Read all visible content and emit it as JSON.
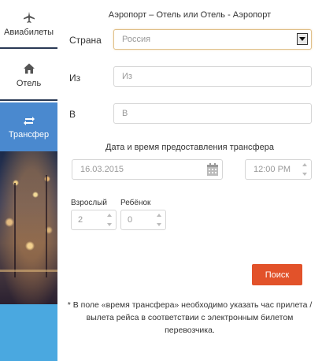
{
  "sidebar": {
    "tabs": [
      {
        "label": "Авиабилеты",
        "icon": "airplane-icon"
      },
      {
        "label": "Отель",
        "icon": "home-icon"
      },
      {
        "label": "Трансфер",
        "icon": "swap-arrows-icon"
      }
    ],
    "active_tab": "Трансфер"
  },
  "form": {
    "title": "Аэропорт – Отель или Отель - Аэропорт",
    "country_label": "Страна",
    "country_value": "Россия",
    "from_label": "Из",
    "from_placeholder": "Из",
    "to_label": "В",
    "to_placeholder": "В",
    "datetime_heading": "Дата и время предоставления трансфера",
    "date_value": "16.03.2015",
    "time_value": "12:00 PM",
    "adult_label": "Взрослый",
    "adult_value": "2",
    "child_label": "Ребёнок",
    "child_value": "0",
    "search_label": "Поиск",
    "note": "* В поле «время трансфера» необходимо указать час прилета / вылета рейса в соответствии с электронным билетом перевозчика."
  },
  "colors": {
    "accent_button": "#e2522a",
    "active_tab": "#4a89cf",
    "tab_border": "#2a3a55"
  }
}
